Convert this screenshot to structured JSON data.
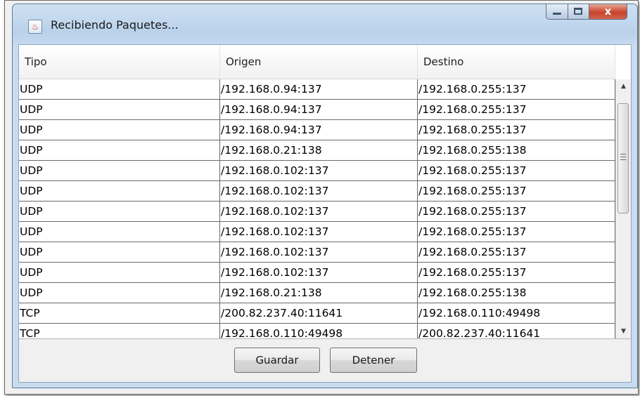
{
  "window": {
    "title": "Recibiendo Paquetes...",
    "app_icon": "java-cup-icon",
    "close_glyph": "x"
  },
  "table": {
    "columns": [
      "Tipo",
      "Origen",
      "Destino"
    ],
    "rows": [
      [
        "UDP",
        "/192.168.0.94:137",
        "/192.168.0.255:137"
      ],
      [
        "UDP",
        "/192.168.0.94:137",
        "/192.168.0.255:137"
      ],
      [
        "UDP",
        "/192.168.0.94:137",
        "/192.168.0.255:137"
      ],
      [
        "UDP",
        "/192.168.0.21:138",
        "/192.168.0.255:138"
      ],
      [
        "UDP",
        "/192.168.0.102:137",
        "/192.168.0.255:137"
      ],
      [
        "UDP",
        "/192.168.0.102:137",
        "/192.168.0.255:137"
      ],
      [
        "UDP",
        "/192.168.0.102:137",
        "/192.168.0.255:137"
      ],
      [
        "UDP",
        "/192.168.0.102:137",
        "/192.168.0.255:137"
      ],
      [
        "UDP",
        "/192.168.0.102:137",
        "/192.168.0.255:137"
      ],
      [
        "UDP",
        "/192.168.0.102:137",
        "/192.168.0.255:137"
      ],
      [
        "UDP",
        "/192.168.0.21:138",
        "/192.168.0.255:138"
      ],
      [
        "TCP",
        "/200.82.237.40:11641",
        "/192.168.0.110:49498"
      ],
      [
        "TCP",
        "/192.168.0.110:49498",
        "/200.82.237.40:11641"
      ]
    ]
  },
  "buttons": {
    "save_label": "Guardar",
    "stop_label": "Detener"
  },
  "colors": {
    "titlebar": "#b9d1ea",
    "close_button": "#c8442b",
    "grid_line": "#6a6a6a"
  }
}
